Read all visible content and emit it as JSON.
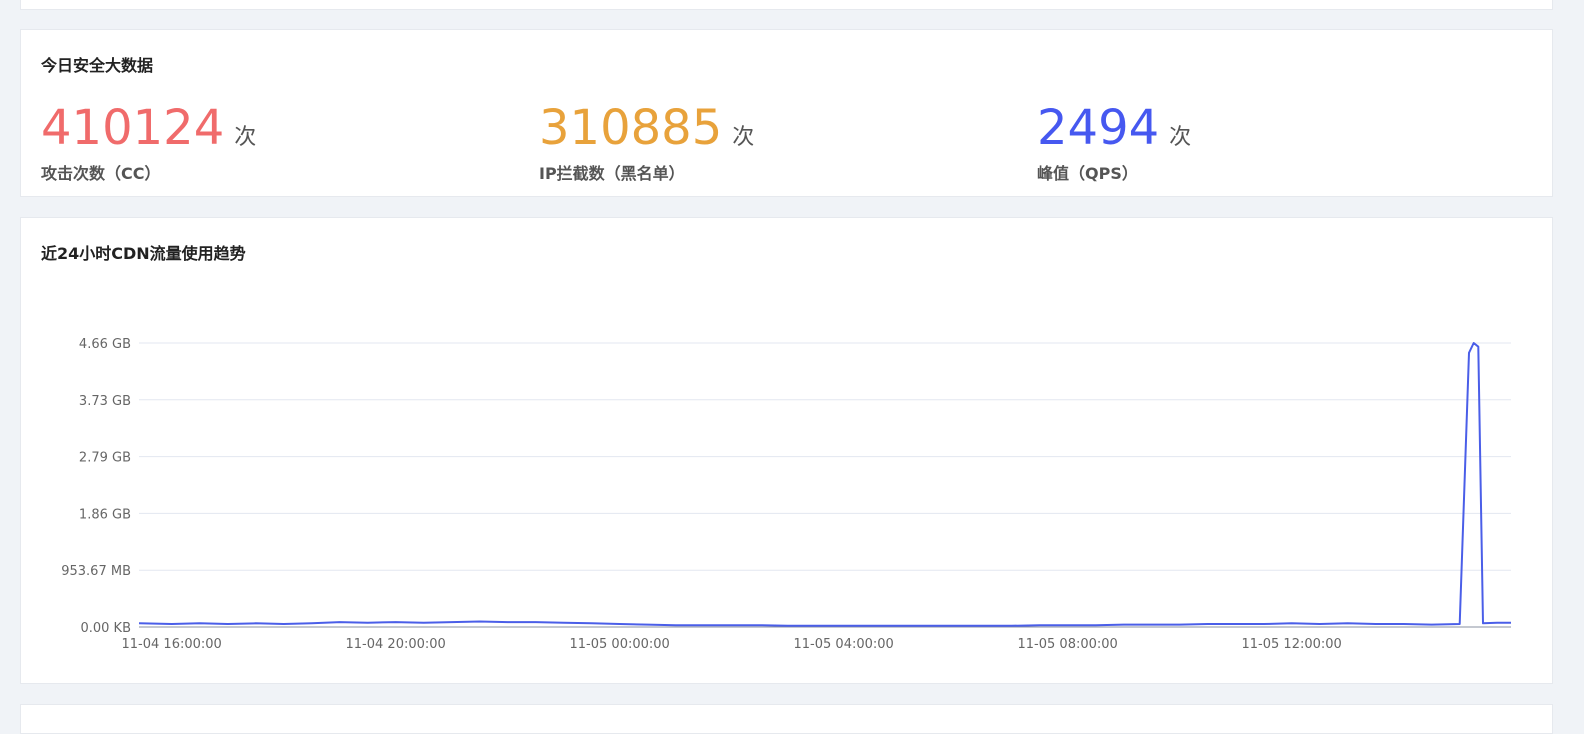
{
  "security_card": {
    "title": "今日安全大数据",
    "stats": [
      {
        "value": "410124",
        "unit": "次",
        "label": "攻击次数（CC）",
        "color": "#f06b6b"
      },
      {
        "value": "310885",
        "unit": "次",
        "label": "IP拦截数（黑名单）",
        "color": "#e8a23b"
      },
      {
        "value": "2494",
        "unit": "次",
        "label": "峰值（QPS）",
        "color": "#4658f0"
      }
    ]
  },
  "chart_card": {
    "title": "近24小时CDN流量使用趋势"
  },
  "chart_data": {
    "type": "line",
    "title": "近24小时CDN流量使用趋势",
    "ytick_labels": [
      "0.00 KB",
      "953.67 MB",
      "1.86 GB",
      "2.79 GB",
      "3.73 GB",
      "4.66 GB"
    ],
    "ylim_gb": [
      0,
      4.66
    ],
    "xtick_labels": [
      "11-04 16:00:00",
      "11-04 20:00:00",
      "11-05 00:00:00",
      "11-05 04:00:00",
      "11-05 08:00:00",
      "11-05 12:00:00"
    ],
    "x_range": [
      "11-04 15:25:00",
      "11-05 15:55:00"
    ],
    "series": [
      {
        "color": "#4a5ee8",
        "points_gb": [
          [
            "11-04 15:25",
            0.06
          ],
          [
            "11-04 16:00",
            0.05
          ],
          [
            "11-04 16:30",
            0.06
          ],
          [
            "11-04 17:00",
            0.05
          ],
          [
            "11-04 17:30",
            0.06
          ],
          [
            "11-04 18:00",
            0.05
          ],
          [
            "11-04 18:30",
            0.06
          ],
          [
            "11-04 19:00",
            0.08
          ],
          [
            "11-04 19:30",
            0.07
          ],
          [
            "11-04 20:00",
            0.08
          ],
          [
            "11-04 20:30",
            0.07
          ],
          [
            "11-04 21:00",
            0.08
          ],
          [
            "11-04 21:30",
            0.09
          ],
          [
            "11-04 22:00",
            0.08
          ],
          [
            "11-04 22:30",
            0.08
          ],
          [
            "11-04 23:00",
            0.07
          ],
          [
            "11-04 23:30",
            0.06
          ],
          [
            "11-05 00:00",
            0.05
          ],
          [
            "11-05 00:30",
            0.04
          ],
          [
            "11-05 01:00",
            0.03
          ],
          [
            "11-05 01:30",
            0.03
          ],
          [
            "11-05 02:00",
            0.03
          ],
          [
            "11-05 02:30",
            0.03
          ],
          [
            "11-05 03:00",
            0.02
          ],
          [
            "11-05 03:30",
            0.02
          ],
          [
            "11-05 04:00",
            0.02
          ],
          [
            "11-05 04:30",
            0.02
          ],
          [
            "11-05 05:00",
            0.02
          ],
          [
            "11-05 05:30",
            0.02
          ],
          [
            "11-05 06:00",
            0.02
          ],
          [
            "11-05 06:30",
            0.02
          ],
          [
            "11-05 07:00",
            0.02
          ],
          [
            "11-05 07:30",
            0.03
          ],
          [
            "11-05 08:00",
            0.03
          ],
          [
            "11-05 08:30",
            0.03
          ],
          [
            "11-05 09:00",
            0.04
          ],
          [
            "11-05 09:30",
            0.04
          ],
          [
            "11-05 10:00",
            0.04
          ],
          [
            "11-05 10:30",
            0.05
          ],
          [
            "11-05 11:00",
            0.05
          ],
          [
            "11-05 11:30",
            0.05
          ],
          [
            "11-05 12:00",
            0.06
          ],
          [
            "11-05 12:30",
            0.05
          ],
          [
            "11-05 13:00",
            0.06
          ],
          [
            "11-05 13:30",
            0.05
          ],
          [
            "11-05 14:00",
            0.05
          ],
          [
            "11-05 14:30",
            0.04
          ],
          [
            "11-05 15:00",
            0.05
          ],
          [
            "11-05 15:10",
            4.5
          ],
          [
            "11-05 15:15",
            4.66
          ],
          [
            "11-05 15:20",
            4.6
          ],
          [
            "11-05 15:25",
            0.06
          ],
          [
            "11-05 15:40",
            0.07
          ],
          [
            "11-05 15:55",
            0.07
          ]
        ]
      }
    ],
    "grid": true
  }
}
